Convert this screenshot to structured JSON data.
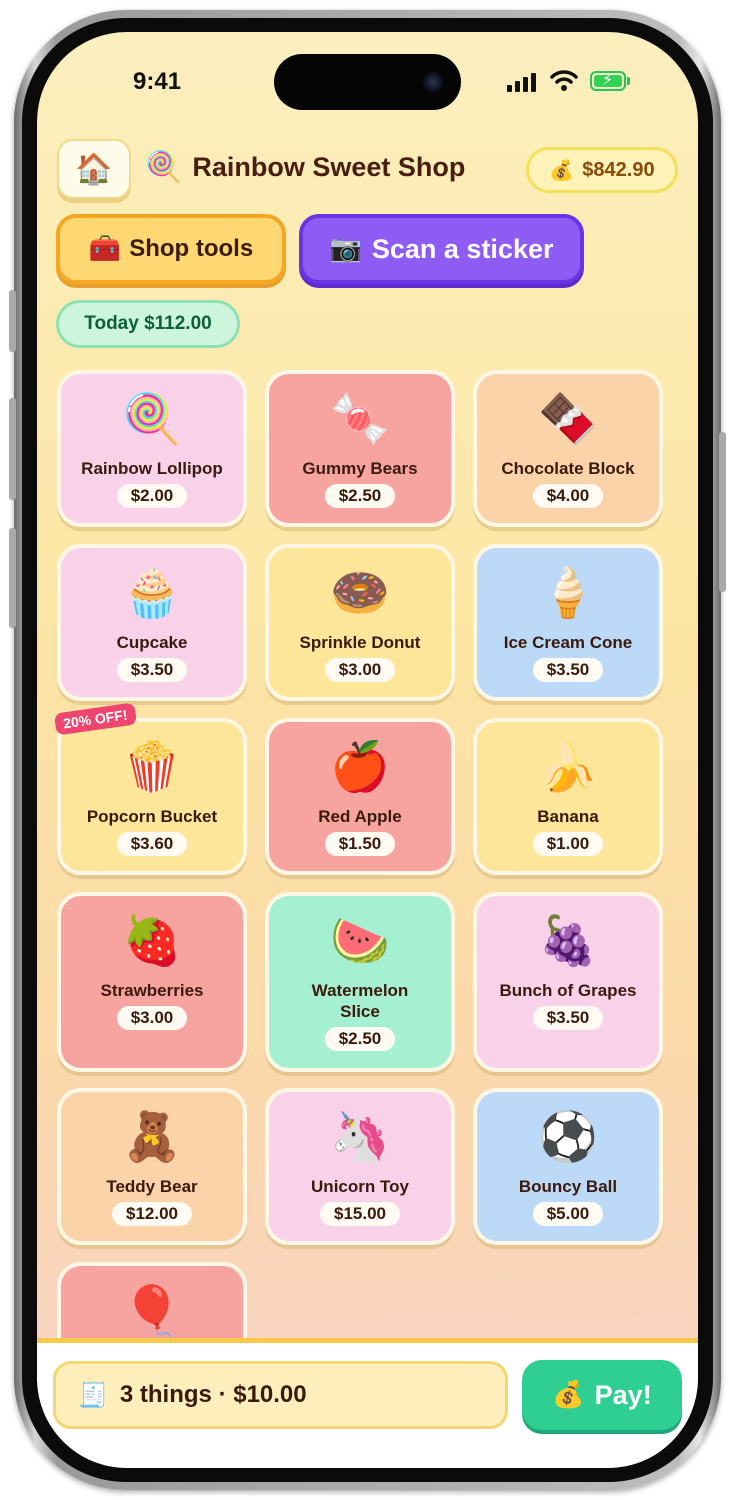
{
  "status_bar": {
    "time": "9:41"
  },
  "header": {
    "home_icon": "🏠",
    "title_icon": "🍭",
    "title": "Rainbow Sweet Shop",
    "balance_icon": "💰",
    "balance": "$842.90"
  },
  "actions": {
    "tools_icon": "🧰",
    "tools_label": "Shop tools",
    "scan_icon": "📷",
    "scan_label": "Scan a sticker"
  },
  "today": "Today $112.00",
  "sale_badge": "20% OFF!",
  "products": [
    {
      "emoji": "🍭",
      "name": "Rainbow Lollipop",
      "price": "$2.00"
    },
    {
      "emoji": "🍬",
      "name": "Gummy Bears",
      "price": "$2.50"
    },
    {
      "emoji": "🍫",
      "name": "Chocolate Block",
      "price": "$4.00"
    },
    {
      "emoji": "🧁",
      "name": "Cupcake",
      "price": "$3.50"
    },
    {
      "emoji": "🍩",
      "name": "Sprinkle Donut",
      "price": "$3.00"
    },
    {
      "emoji": "🍦",
      "name": "Ice Cream Cone",
      "price": "$3.50"
    },
    {
      "emoji": "🍿",
      "name": "Popcorn Bucket",
      "price": "$3.60"
    },
    {
      "emoji": "🍎",
      "name": "Red Apple",
      "price": "$1.50"
    },
    {
      "emoji": "🍌",
      "name": "Banana",
      "price": "$1.00"
    },
    {
      "emoji": "🍓",
      "name": "Strawberries",
      "price": "$3.00"
    },
    {
      "emoji": "🍉",
      "name": "Watermelon Slice",
      "price": "$2.50"
    },
    {
      "emoji": "🍇",
      "name": "Bunch of Grapes",
      "price": "$3.50"
    },
    {
      "emoji": "🧸",
      "name": "Teddy Bear",
      "price": "$12.00"
    },
    {
      "emoji": "🦄",
      "name": "Unicorn Toy",
      "price": "$15.00"
    },
    {
      "emoji": "⚽",
      "name": "Bouncy Ball",
      "price": "$5.00"
    },
    {
      "emoji": "🎈"
    }
  ],
  "cart": {
    "icon": "🧾",
    "summary": "3 things · $10.00"
  },
  "pay": {
    "icon": "💰",
    "label": "Pay!"
  }
}
